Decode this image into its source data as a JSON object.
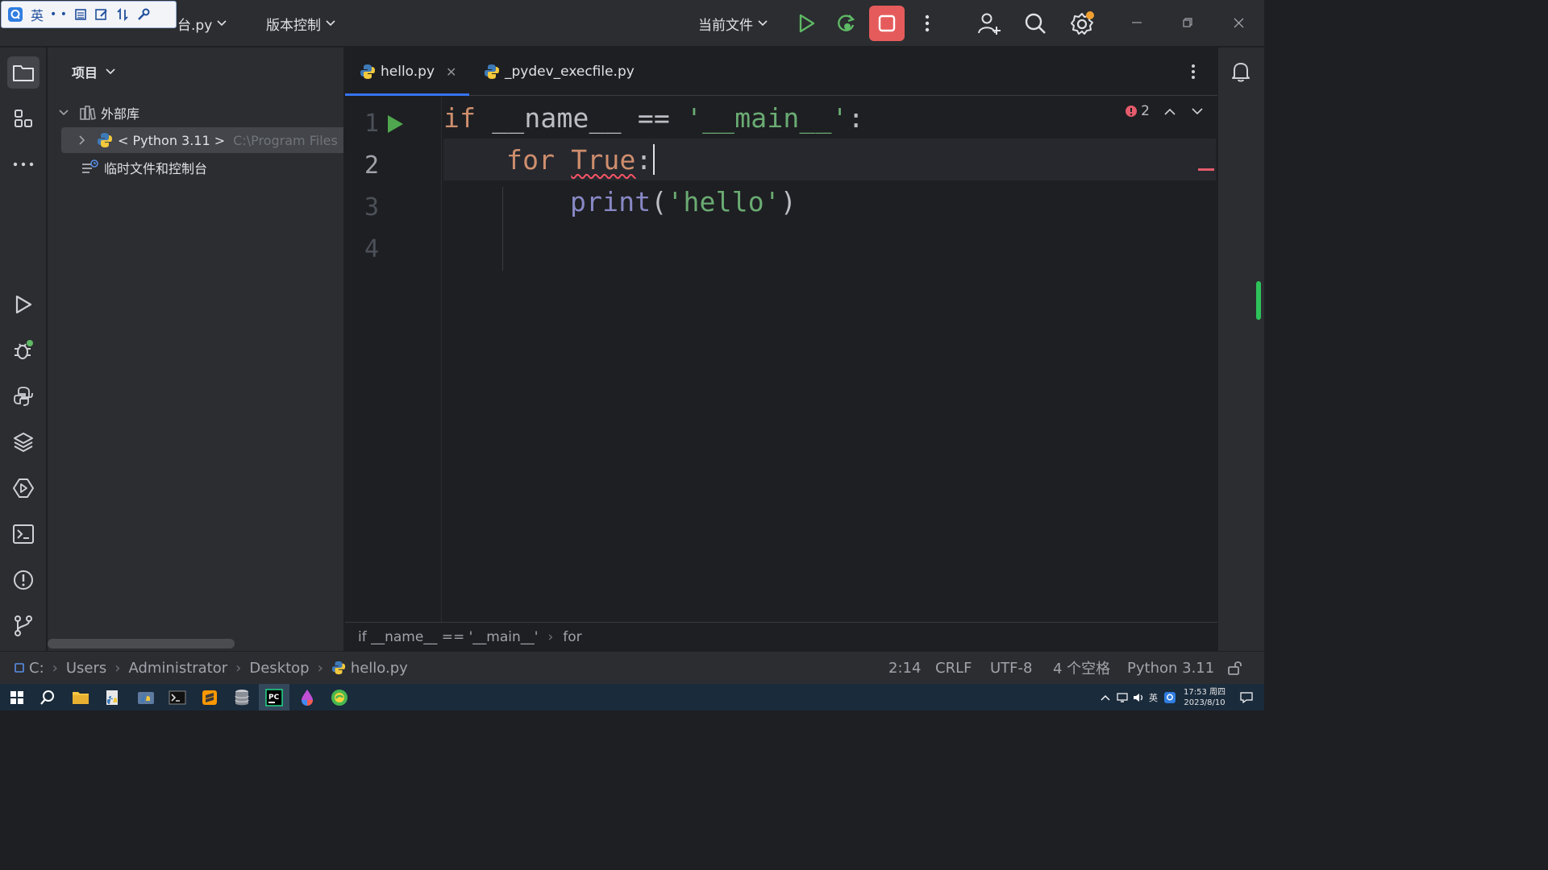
{
  "titlebar": {
    "file_name": "台.py",
    "vcs_menu": "版本控制",
    "run_config": "当前文件"
  },
  "ime": {
    "lang": "英"
  },
  "project_panel": {
    "title": "项目",
    "tree": [
      {
        "label": "外部库",
        "expanded": true
      },
      {
        "label": "< Python 3.11 >",
        "detail": "C:\\Program Files",
        "selected": true
      },
      {
        "label": "临时文件和控制台"
      }
    ]
  },
  "editor": {
    "tabs": [
      {
        "label": "hello.py",
        "active": true
      },
      {
        "label": "_pydev_execfile.py",
        "active": false
      }
    ],
    "line_numbers": [
      "1",
      "2",
      "3",
      "4"
    ],
    "code": {
      "l1_kw": "if",
      "l1_rest": " __name__ == ",
      "l1_str": "'__main__'",
      "l1_colon": ":",
      "l2_kw": "for",
      "l2_err": "True",
      "l2_colon": ":",
      "l3_fn": "print",
      "l3_open": "(",
      "l3_str": "'hello'",
      "l3_close": ")"
    },
    "problems_count": "2",
    "breadcrumbs": [
      "if __name__ == '__main__'",
      "for"
    ]
  },
  "statusbar": {
    "path": [
      "C:",
      "Users",
      "Administrator",
      "Desktop",
      "hello.py"
    ],
    "position": "2:14",
    "line_sep": "CRLF",
    "encoding": "UTF-8",
    "indent": "4 个空格",
    "interpreter": "Python 3.11"
  },
  "taskbar": {
    "ime": "英",
    "time": "17:53 周四",
    "date": "2023/8/10"
  },
  "colors": {
    "accent": "#3574f0",
    "run_green": "#4fa64f",
    "stop_red": "#e55b5b",
    "error": "#f75464"
  }
}
